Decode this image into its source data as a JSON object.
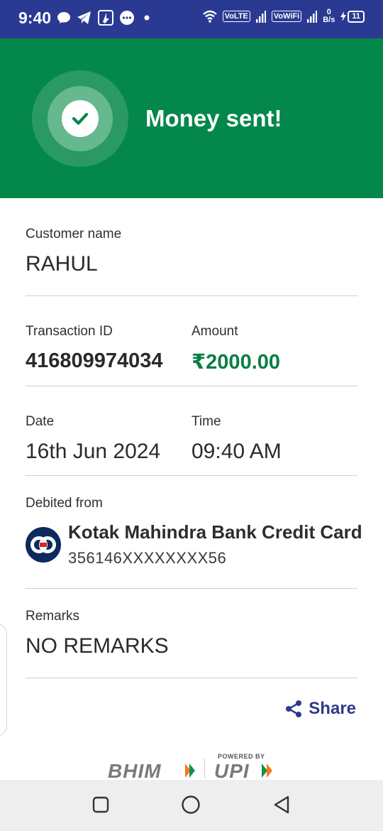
{
  "status_bar": {
    "time": "9:40",
    "volte": "VoLTE",
    "vowifi": "VoWiFi",
    "net_speed_value": "0",
    "net_speed_unit": "B/s",
    "battery": "11",
    "icons": [
      "chat-bubble-icon",
      "telegram-icon",
      "app-icon",
      "messages-icon",
      "dot-icon",
      "wifi-icon",
      "signal-icon",
      "charging-icon"
    ]
  },
  "header": {
    "title": "Money sent!",
    "colors": {
      "background": "#04874a",
      "check": "#04874a"
    }
  },
  "customer": {
    "label": "Customer name",
    "value": "RAHUL"
  },
  "transaction": {
    "id_label": "Transaction ID",
    "id_value": "416809974034",
    "amount_label": "Amount",
    "amount_value": "₹2000.00",
    "amount_color": "#0b7d45"
  },
  "datetime": {
    "date_label": "Date",
    "date_value": "16th Jun 2024",
    "time_label": "Time",
    "time_value": "09:40 AM"
  },
  "debit": {
    "label": "Debited from",
    "bank_name": "Kotak Mahindra Bank Credit Card",
    "account": "356146XXXXXXXX56"
  },
  "remarks": {
    "label": "Remarks",
    "value": "NO REMARKS"
  },
  "share": {
    "label": "Share"
  },
  "footer": {
    "bhim": "BHIM",
    "powered_by": "POWERED BY",
    "upi": "UPI"
  },
  "nav": {
    "icons": [
      "recents-icon",
      "home-icon",
      "back-icon"
    ]
  }
}
